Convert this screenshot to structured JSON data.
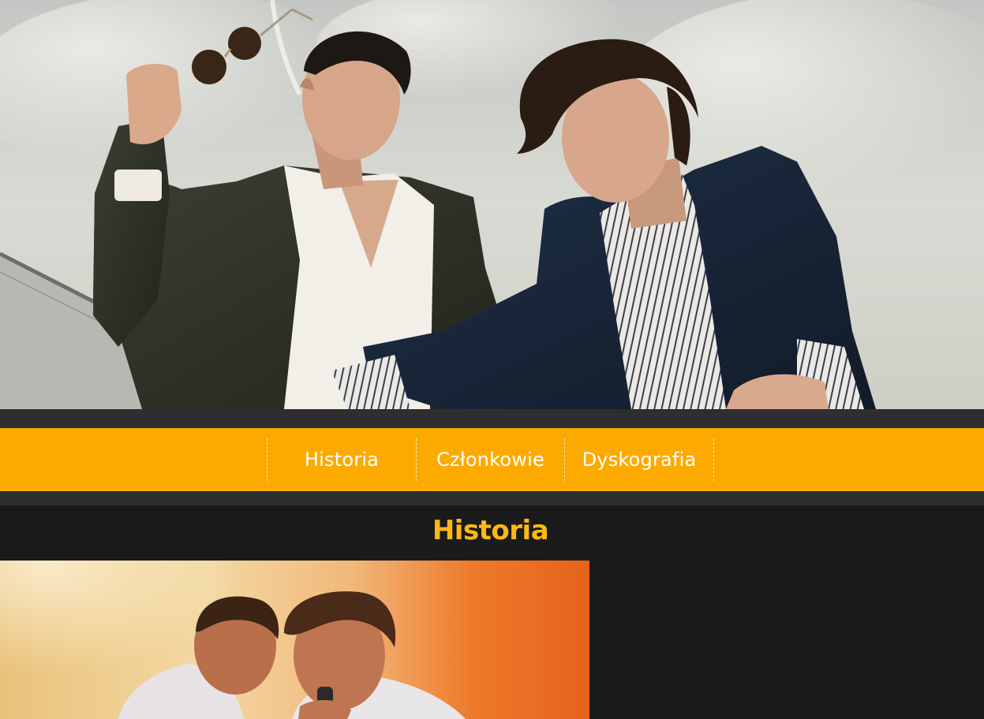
{
  "nav": {
    "items": [
      {
        "label": "Historia"
      },
      {
        "label": "Członkowie"
      },
      {
        "label": "Dyskografia"
      }
    ]
  },
  "section": {
    "title": "Historia"
  },
  "colors": {
    "accent": "#fdaa00",
    "title": "#fdb813",
    "background": "#1b1a1b",
    "strip": "#2e2e2f"
  }
}
